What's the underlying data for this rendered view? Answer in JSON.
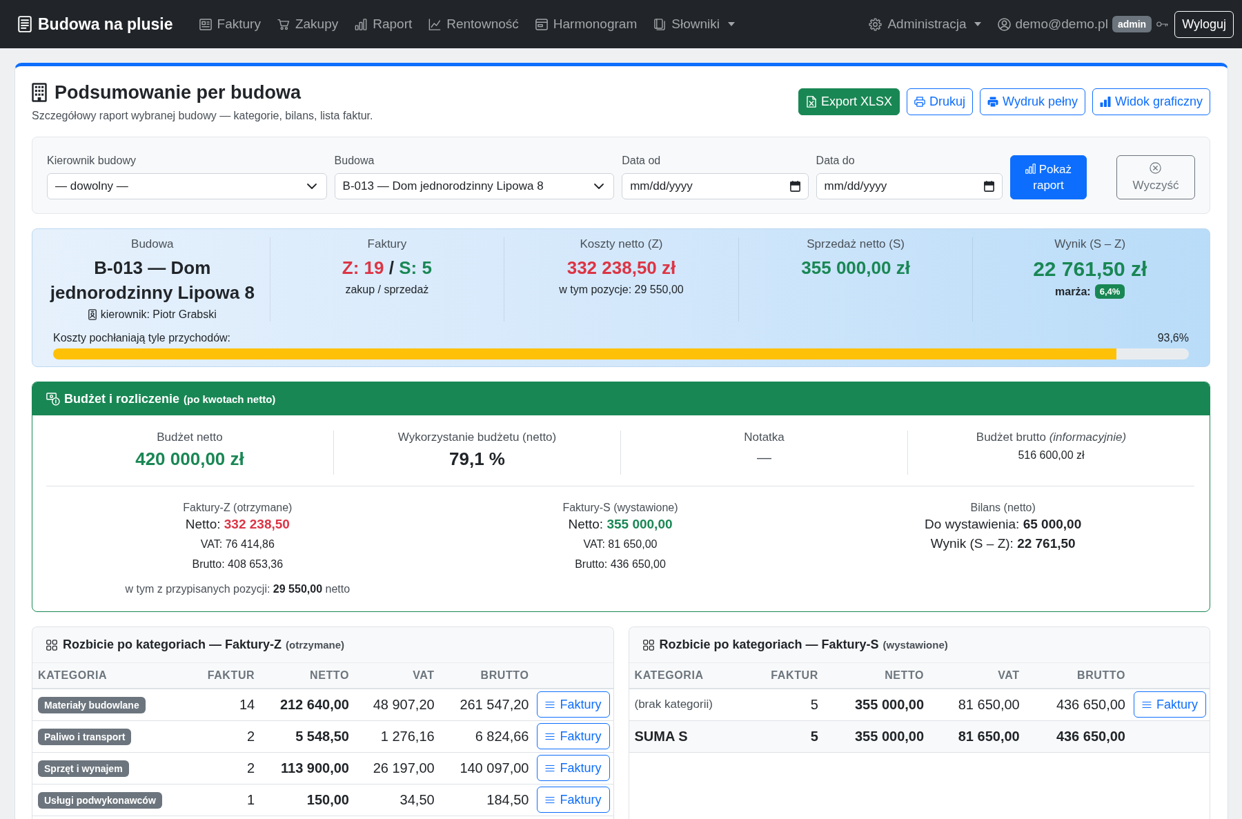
{
  "navbar": {
    "brand": "Budowa na plusie",
    "links": [
      {
        "label": "Faktury",
        "dropdown": false
      },
      {
        "label": "Zakupy",
        "dropdown": false
      },
      {
        "label": "Raport",
        "dropdown": false
      },
      {
        "label": "Rentowność",
        "dropdown": false
      },
      {
        "label": "Harmonogram",
        "dropdown": false
      },
      {
        "label": "Słowniki",
        "dropdown": true
      }
    ],
    "admin": {
      "label": "Administracja",
      "dropdown": true
    },
    "user": {
      "email": "demo@demo.pl",
      "role": "admin"
    },
    "logout": "Wyloguj"
  },
  "header": {
    "title": "Podsumowanie per budowa",
    "subtitle": "Szczegółowy raport wybranej budowy — kategorie, bilans, lista faktur.",
    "actions": [
      {
        "label": "Export XLSX",
        "kind": "filled"
      },
      {
        "label": "Drukuj",
        "kind": "outline"
      },
      {
        "label": "Wydruk pełny",
        "kind": "outline"
      },
      {
        "label": "Widok graficzny",
        "kind": "outline"
      }
    ]
  },
  "filters": {
    "fields": [
      {
        "kind": "select",
        "label": "Kierownik budowy",
        "value": "— dowolny —"
      },
      {
        "kind": "select",
        "label": "Budowa",
        "value": "B-013 — Dom jednorodzinny Lipowa 8"
      },
      {
        "kind": "date",
        "label": "Data od",
        "placeholder": "mm/dd/yyyy"
      },
      {
        "kind": "date",
        "label": "Data do",
        "placeholder": "mm/dd/yyyy"
      }
    ],
    "buttons": [
      {
        "label": "Pokaż raport",
        "kind": "primary"
      },
      {
        "label": "Wyczyść",
        "kind": "secondary"
      }
    ]
  },
  "summary": {
    "stats": [
      {
        "kind": "site",
        "label": "Budowa",
        "value": "B-013 — Dom jednorodzinny Lipowa 8",
        "note": "kierownik: Piotr Grabski"
      },
      {
        "kind": "counts",
        "label": "Faktury",
        "parts": [
          {
            "text": "Z: 19",
            "color": "#dc3545"
          },
          {
            "text": "/",
            "color": "#212529"
          },
          {
            "text": "S: 5",
            "color": "#198754"
          }
        ],
        "note": "zakup / sprzedaż"
      },
      {
        "kind": "amount",
        "label": "Koszty netto (Z)",
        "value": "332 238,50 zł",
        "color": "#dc3545",
        "note": "w tym pozycje: 29 550,00"
      },
      {
        "kind": "amount",
        "label": "Sprzedaż netto (S)",
        "value": "355 000,00 zł",
        "color": "#198754"
      },
      {
        "kind": "result",
        "label": "Wynik (S – Z)",
        "value": "22 761,50 zł",
        "color": "#198754",
        "note": "marża:",
        "badge": "6,4%"
      }
    ],
    "progress": {
      "label": "Koszty pochłaniają tyle przychodów:",
      "reading": "93,6%",
      "level": 0.936
    }
  },
  "budget": {
    "title": "Budżet i rozliczenie",
    "subtitle": "(po kwotach netto)",
    "metrics": [
      {
        "kind": "amount",
        "label": "Budżet netto",
        "value": "420 000,00 zł",
        "color": "#198754"
      },
      {
        "kind": "amount",
        "label": "Wykorzystanie budżetu (netto)",
        "value": "79,1 %",
        "color": "#212529"
      },
      {
        "kind": "note",
        "label": "Notatka",
        "value": "—"
      },
      {
        "kind": "plain",
        "label": "Budżet brutto *(informacyjnie)*",
        "value": "516 600,00 zł"
      }
    ],
    "settlement": [
      {
        "title": "Faktury-Z (otrzymane)",
        "lines": [
          {
            "kind": "primary",
            "label": "Netto:",
            "value": "332 238,50",
            "color": "#dc3545"
          },
          {
            "kind": "secondary",
            "text": "VAT: 76 414,86"
          },
          {
            "kind": "secondary",
            "text": "Brutto: 408 653,36"
          }
        ],
        "footnote": "w tym z przypisanych pozycji: **29 550,00** netto"
      },
      {
        "title": "Faktury-S (wystawione)",
        "lines": [
          {
            "kind": "primary",
            "label": "Netto:",
            "value": "355 000,00",
            "color": "#198754"
          },
          {
            "kind": "secondary",
            "text": "VAT: 81 650,00"
          },
          {
            "kind": "secondary",
            "text": "Brutto: 436 650,00"
          }
        ]
      },
      {
        "title": "Bilans (netto)",
        "lines": [
          {
            "kind": "primary",
            "label": "Do wystawienia:",
            "value": "65 000,00"
          },
          {
            "kind": "primary",
            "label": "Wynik (S – Z):",
            "value": "22 761,50"
          }
        ]
      }
    ]
  },
  "tables": [
    {
      "title": "Rozbicie po kategoriach — Faktury-Z",
      "subtitle": "(otrzymane)",
      "columns": [
        "KATEGORIA",
        "FAKTUR",
        "NETTO",
        "VAT",
        "BRUTTO"
      ],
      "rows": [
        {
          "kind": "category",
          "category": "Materiały budowlane",
          "count": "14",
          "net": "212 640,00",
          "vat": "48 907,20",
          "gross": "261 547,20",
          "action": "Faktury"
        },
        {
          "kind": "category",
          "category": "Paliwo i transport",
          "count": "2",
          "net": "5 548,50",
          "vat": "1 276,16",
          "gross": "6 824,66",
          "action": "Faktury"
        },
        {
          "kind": "category",
          "category": "Sprzęt i wynajem",
          "count": "2",
          "net": "113 900,00",
          "vat": "26 197,00",
          "gross": "140 097,00",
          "action": "Faktury"
        },
        {
          "kind": "category",
          "category": "Usługi podwykonawców",
          "count": "1",
          "net": "150,00",
          "vat": "34,50",
          "gross": "184,50",
          "action": "Faktury"
        }
      ]
    },
    {
      "title": "Rozbicie po kategoriach — Faktury-S",
      "subtitle": "(wystawione)",
      "columns": [
        "KATEGORIA",
        "FAKTUR",
        "NETTO",
        "VAT",
        "BRUTTO"
      ],
      "rows": [
        {
          "kind": "uncategorized",
          "category": "(brak kategorii)",
          "count": "5",
          "net": "355 000,00",
          "vat": "81 650,00",
          "gross": "436 650,00",
          "action": "Faktury"
        },
        {
          "kind": "total",
          "category": "SUMA S",
          "count": "5",
          "net": "355 000,00",
          "vat": "81 650,00",
          "gross": "436 650,00"
        }
      ]
    }
  ]
}
